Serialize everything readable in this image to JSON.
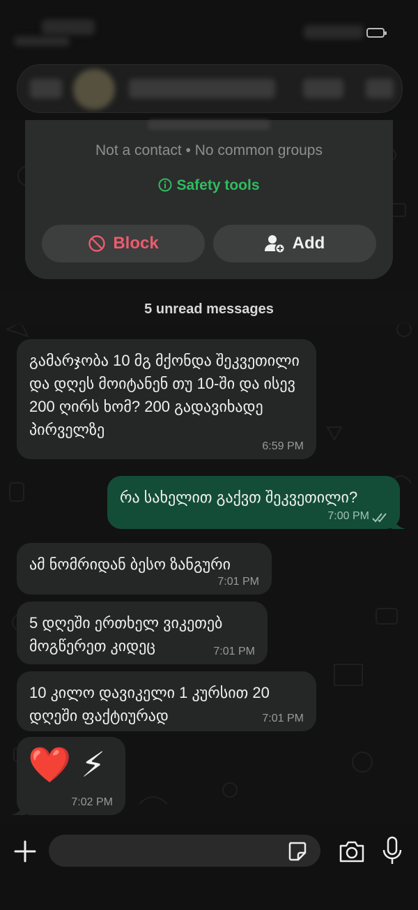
{
  "card": {
    "subtitle": "Not a contact • No common groups",
    "safety_label": "Safety tools",
    "block_label": "Block",
    "add_label": "Add"
  },
  "unread_label": "5 unread messages",
  "messages": [
    {
      "direction": "in",
      "text": "გამარჯობა 10 მგ მქონდა შეკვეთილი და დღეს მოიტანენ თუ 10-ში და ისევ 200 ღირს ხომ? 200 გადავიხადე პირველზე",
      "time": "6:59 PM"
    },
    {
      "direction": "out",
      "text": "რა სახელით გაქვთ შეკვეთილი?",
      "time": "7:00 PM",
      "status": "read"
    },
    {
      "direction": "in",
      "text": "ამ ნომრიდან ბესო ზანგური",
      "time": "7:01 PM"
    },
    {
      "direction": "in",
      "text": "5 დღეში ერთხელ ვიკეთებ მოგწერეთ კიდეც",
      "time": "7:01 PM"
    },
    {
      "direction": "in",
      "text": "10 კილო დავიკელი 1 კურსით 20 დღეში ფაქტიურად",
      "time": "7:01 PM"
    },
    {
      "direction": "in",
      "text": "❤️ ⚡",
      "time": "7:02 PM"
    }
  ],
  "composer": {
    "placeholder": ""
  },
  "colors": {
    "accent_green": "#2fbd5f",
    "block_red": "#ec5c6f",
    "outgoing_bubble": "#144d37",
    "incoming_bubble": "#252626"
  }
}
